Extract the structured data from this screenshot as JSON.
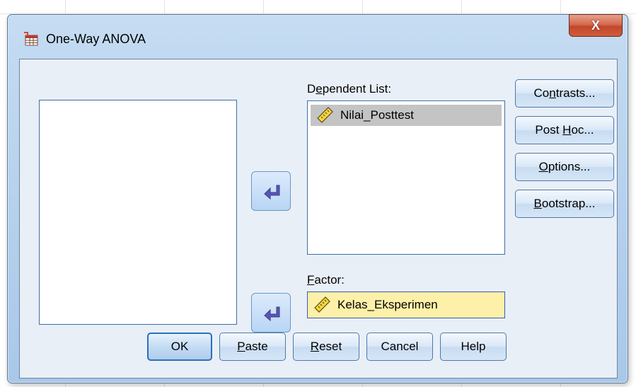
{
  "window": {
    "title": "One-Way ANOVA",
    "close_label": "X"
  },
  "lists": {
    "dependent_label_pre": "D",
    "dependent_label_key": "e",
    "dependent_label_post": "pendent List:",
    "dependent_items": [
      "Nilai_Posttest"
    ],
    "factor_label_key": "F",
    "factor_label_post": "actor:",
    "factor_value": "Kelas_Eksperimen"
  },
  "side_buttons": {
    "contrasts": {
      "pre": "Co",
      "key": "n",
      "post": "trasts..."
    },
    "post_hoc": {
      "pre": "Post ",
      "key": "H",
      "post": "oc..."
    },
    "options": {
      "pre": "",
      "key": "O",
      "post": "ptions..."
    },
    "bootstrap": {
      "pre": "",
      "key": "B",
      "post": "ootstrap..."
    }
  },
  "bottom_buttons": {
    "ok": "OK",
    "paste": {
      "key": "P",
      "post": "aste"
    },
    "reset": {
      "key": "R",
      "post": "eset"
    },
    "cancel": "Cancel",
    "help": "Help"
  },
  "icons": {
    "app": "spss-table-icon",
    "scale_variable": "ruler-icon",
    "move_arrow": "move-left-arrow-icon"
  },
  "colors": {
    "factor_bg": "#fdf0a8",
    "selected_item_bg": "#c4c4c4",
    "close_red": "#c2472b"
  }
}
